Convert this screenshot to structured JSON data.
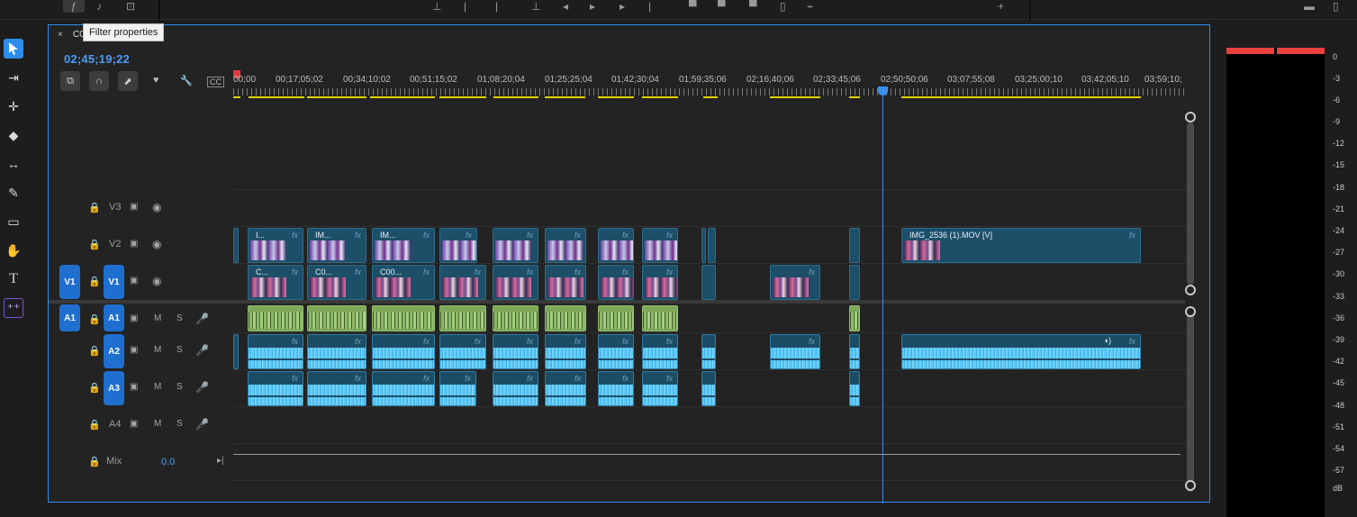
{
  "tooltip": {
    "text": "Filter properties"
  },
  "timeline": {
    "tab_name": "C0",
    "timecode": "02;45;19;22",
    "ruler_labels": [
      "00;00",
      "00;17;05;02",
      "00;34;10;02",
      "00;51;15;02",
      "01;08;20;04",
      "01;25;25;04",
      "01;42;30;04",
      "01;59;35;06",
      "02;16;40;06",
      "02;33;45;06",
      "02;50;50;06",
      "03;07;55;08",
      "03;25;00;10",
      "03;42;05;10",
      "03;59;10;"
    ],
    "tracks": {
      "v3": {
        "name": "V3"
      },
      "v2": {
        "name": "V2"
      },
      "v1": {
        "name": "V1",
        "source": "V1"
      },
      "a1": {
        "name": "A1",
        "source": "A1"
      },
      "a2": {
        "name": "A2"
      },
      "a3": {
        "name": "A3"
      },
      "a4": {
        "name": "A4"
      },
      "mix": {
        "name": "Mix",
        "value": "0.0"
      }
    },
    "mute_label": "M",
    "solo_label": "S",
    "fx_label": "fx",
    "clips_v2": [
      "I...",
      "IM...",
      "IM...",
      "IMG_2536 (1).MOV [V]"
    ],
    "clips_v1": [
      "C...",
      "C0...",
      "C00..."
    ],
    "colors": {
      "accent": "#2d8ceb",
      "video_clip": "#1d4f69",
      "audio_clip": "#1b4d66",
      "audio_green": "#7ea85a",
      "work_area": "#e0d300"
    }
  },
  "meter": {
    "labels": [
      "0",
      "-3",
      "-6",
      "-9",
      "-12",
      "-15",
      "-18",
      "-21",
      "-24",
      "-27",
      "-30",
      "-33",
      "-36",
      "-39",
      "-42",
      "-45",
      "-48",
      "-51",
      "-54",
      "-57",
      "dB"
    ]
  }
}
